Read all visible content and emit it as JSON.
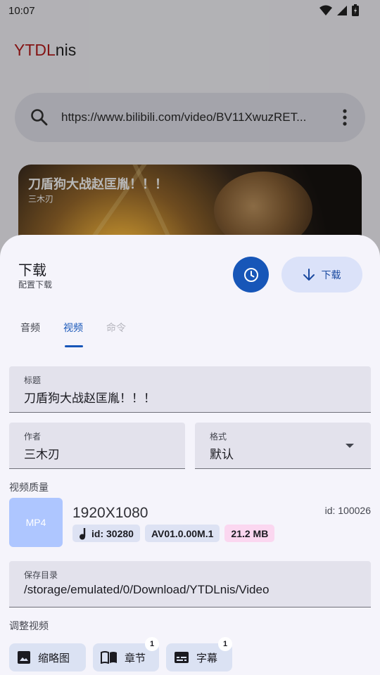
{
  "status_bar": {
    "time": "10:07"
  },
  "app": {
    "title_prefix": "YTDL",
    "title_suffix": "nis",
    "search": {
      "value": "https://www.bilibili.com/video/BV11XwuzRET..."
    },
    "result": {
      "title": "刀盾狗大战赵匡胤！！！",
      "author": "三木刃"
    }
  },
  "sheet": {
    "title": "下载",
    "subtitle": "配置下载",
    "download_label": "下载",
    "tabs": [
      {
        "label": "音频",
        "state": "normal"
      },
      {
        "label": "视频",
        "state": "active"
      },
      {
        "label": "命令",
        "state": "disabled"
      }
    ],
    "fields": {
      "title": {
        "label": "标题",
        "value": "刀盾狗大战赵匡胤！！！"
      },
      "author": {
        "label": "作者",
        "value": "三木刃"
      },
      "format": {
        "label": "格式",
        "value": "默认"
      },
      "save_dir": {
        "label": "保存目录",
        "value": "/storage/emulated/0/Download/YTDLnis/Video"
      }
    },
    "quality": {
      "section_label": "视频质量",
      "container": "MP4",
      "resolution": "1920X1080",
      "id_text": "id: 100026",
      "chips": {
        "audio": "id: 30280",
        "codec": "AV01.0.00M.1",
        "size": "21.2 MB"
      }
    },
    "adjust": {
      "section_label": "调整视频",
      "buttons": [
        {
          "label": "缩略图",
          "icon": "image-icon"
        },
        {
          "label": "章节",
          "icon": "book-icon",
          "badge": "1"
        },
        {
          "label": "字幕",
          "icon": "subtitles-icon",
          "badge": "1"
        }
      ]
    }
  },
  "colors": {
    "primary": "#1756b8",
    "tonal": "#dbe2f9",
    "brand_red": "#b71c1c",
    "size_chip": "#fbd7f0"
  }
}
